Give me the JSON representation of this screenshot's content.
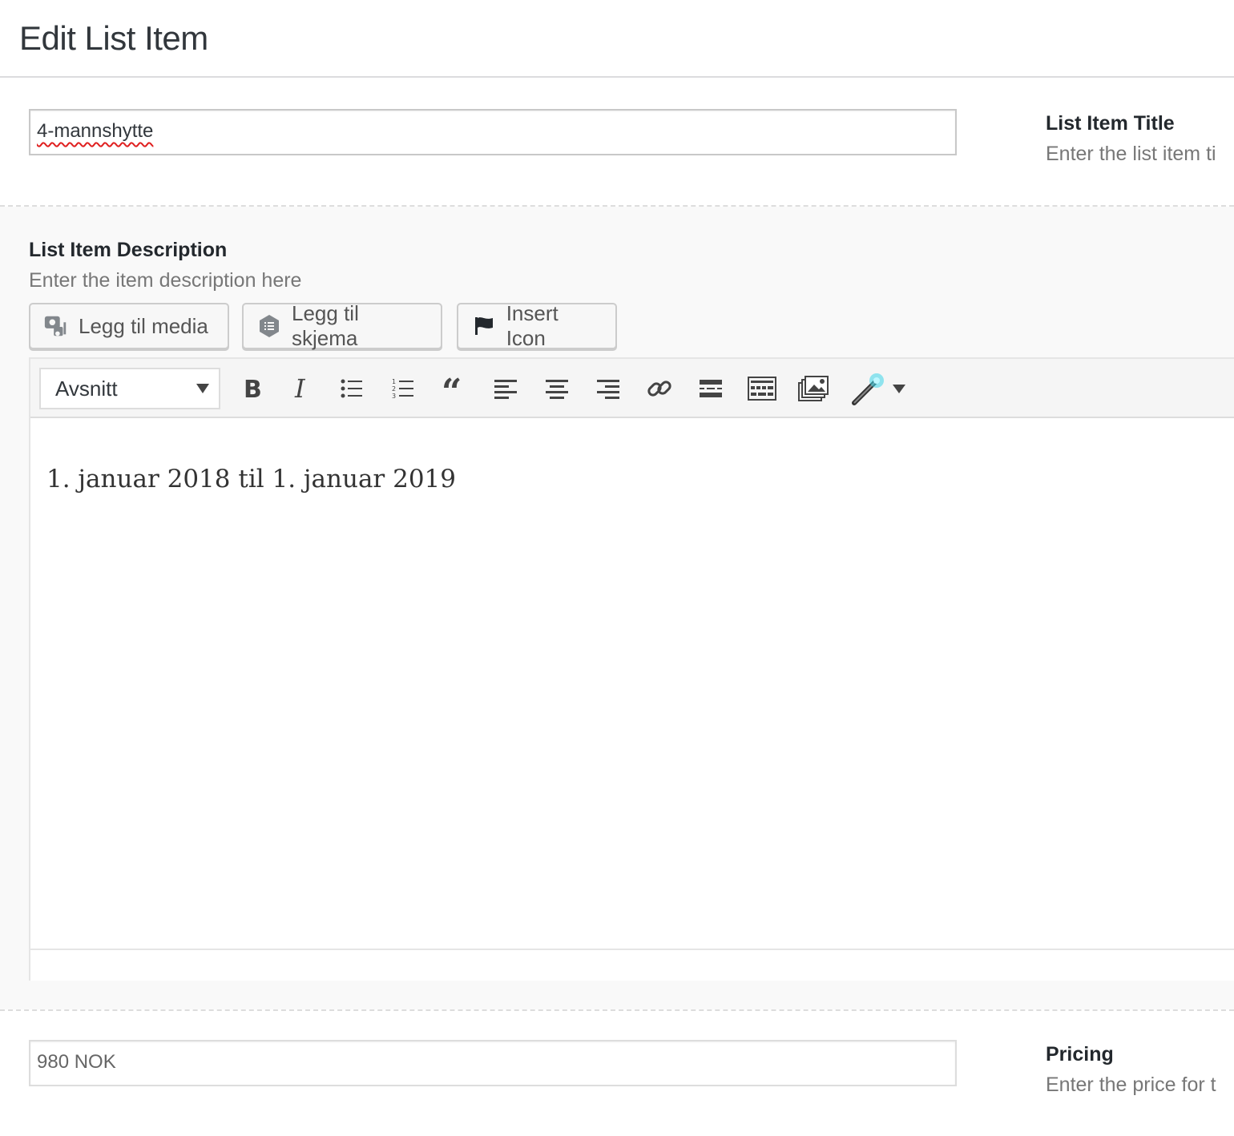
{
  "header": {
    "title": "Edit List Item"
  },
  "title_field": {
    "value": "4-mannshytte",
    "label": "List Item Title",
    "description": "Enter the list item ti"
  },
  "description_field": {
    "label": "List Item Description",
    "description": "Enter the item description here",
    "buttons": {
      "add_media": "Legg til media",
      "add_form": "Legg til skjema",
      "insert_icon": "Insert Icon"
    },
    "toolbar": {
      "format_select": "Avsnitt",
      "icons": [
        "bold-icon",
        "italic-icon",
        "bullet-list-icon",
        "numbered-list-icon",
        "blockquote-icon",
        "align-left-icon",
        "align-center-icon",
        "align-right-icon",
        "link-icon",
        "read-more-icon",
        "toolbar-toggle-icon",
        "gallery-icon",
        "magic-wand-icon"
      ]
    },
    "content": "1. januar 2018 til 1. januar 2019"
  },
  "pricing_field": {
    "value": "980 NOK",
    "label": "Pricing",
    "description": "Enter the price for t"
  },
  "colors": {
    "border": "#c8c8c8",
    "label": "#23282d",
    "help": "#777777",
    "wand_glow": "#3ad3e8"
  }
}
